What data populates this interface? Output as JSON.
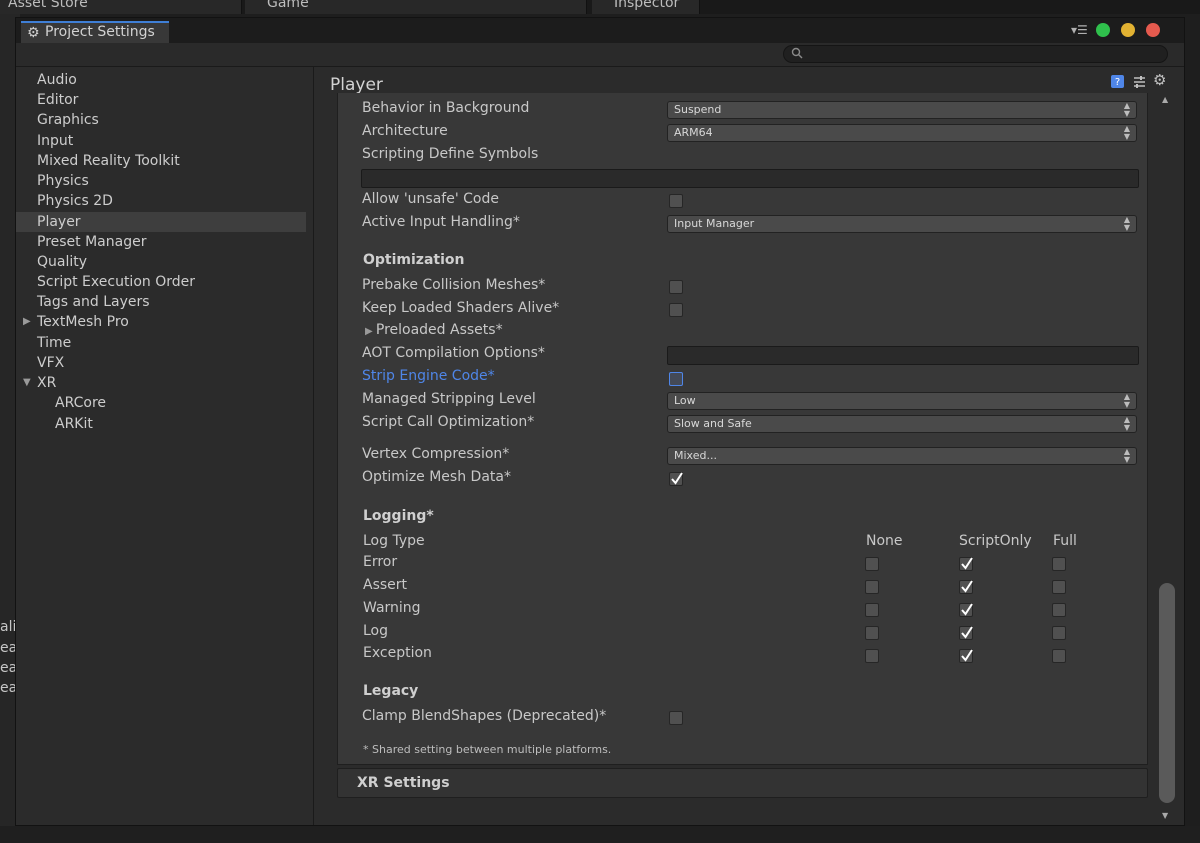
{
  "background": {
    "tabs": [
      "Asset Store",
      "Game",
      "Inspector"
    ],
    "left_texts": [
      "ali",
      "eal",
      "eal",
      "eal"
    ]
  },
  "window": {
    "tab_title": "Project Settings",
    "search_placeholder": "",
    "traffic_colors": [
      "#2fc04c",
      "#e2b232",
      "#e55a4e"
    ]
  },
  "sidebar": {
    "items": [
      {
        "label": "Audio"
      },
      {
        "label": "Editor"
      },
      {
        "label": "Graphics"
      },
      {
        "label": "Input"
      },
      {
        "label": "Mixed Reality Toolkit"
      },
      {
        "label": "Physics"
      },
      {
        "label": "Physics 2D"
      },
      {
        "label": "Player",
        "selected": true
      },
      {
        "label": "Preset Manager"
      },
      {
        "label": "Quality"
      },
      {
        "label": "Script Execution Order"
      },
      {
        "label": "Tags and Layers"
      },
      {
        "label": "TextMesh Pro",
        "collapsed": true
      },
      {
        "label": "Time"
      },
      {
        "label": "VFX"
      },
      {
        "label": "XR",
        "expanded": true
      },
      {
        "label": "ARCore",
        "child": true
      },
      {
        "label": "ARKit",
        "child": true
      }
    ]
  },
  "content": {
    "title": "Player",
    "behavior_in_background": {
      "label": "Behavior in Background",
      "value": "Suspend"
    },
    "architecture": {
      "label": "Architecture",
      "value": "ARM64"
    },
    "scripting_define_symbols": {
      "label": "Scripting Define Symbols",
      "value": ""
    },
    "allow_unsafe": {
      "label": "Allow 'unsafe' Code",
      "checked": false
    },
    "active_input_handling": {
      "label": "Active Input Handling*",
      "value": "Input Manager"
    },
    "optimization": {
      "heading": "Optimization",
      "prebake": {
        "label": "Prebake Collision Meshes*",
        "checked": false
      },
      "keep_shaders": {
        "label": "Keep Loaded Shaders Alive*",
        "checked": false
      },
      "preloaded_assets": {
        "label": "Preloaded Assets*"
      },
      "aot": {
        "label": "AOT Compilation Options*",
        "value": ""
      },
      "strip_engine": {
        "label": "Strip Engine Code*",
        "checked": false
      },
      "managed_stripping": {
        "label": "Managed Stripping Level",
        "value": "Low"
      },
      "script_call": {
        "label": "Script Call Optimization*",
        "value": "Slow and Safe"
      },
      "vertex_compression": {
        "label": "Vertex Compression*",
        "value": "Mixed..."
      },
      "optimize_mesh": {
        "label": "Optimize Mesh Data*",
        "checked": true
      }
    },
    "logging": {
      "heading": "Logging*",
      "log_type_label": "Log Type",
      "columns": [
        "None",
        "ScriptOnly",
        "Full"
      ],
      "rows": [
        {
          "label": "Error",
          "checked": [
            false,
            true,
            false
          ]
        },
        {
          "label": "Assert",
          "checked": [
            false,
            true,
            false
          ]
        },
        {
          "label": "Warning",
          "checked": [
            false,
            true,
            false
          ]
        },
        {
          "label": "Log",
          "checked": [
            false,
            true,
            false
          ]
        },
        {
          "label": "Exception",
          "checked": [
            false,
            true,
            false
          ]
        }
      ]
    },
    "legacy": {
      "heading": "Legacy",
      "clamp": {
        "label": "Clamp BlendShapes (Deprecated)*",
        "checked": false
      }
    },
    "footnote": "* Shared setting between multiple platforms.",
    "xr_settings": "XR Settings"
  }
}
